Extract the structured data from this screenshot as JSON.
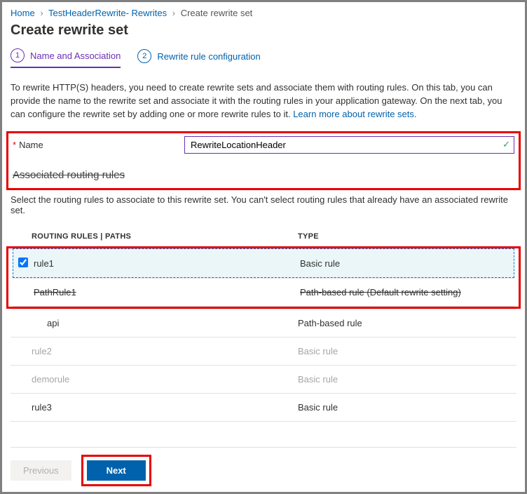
{
  "breadcrumb": {
    "home": "Home",
    "mid": "TestHeaderRewrite- Rewrites",
    "current": "Create rewrite set"
  },
  "page_title": "Create rewrite set",
  "tabs": {
    "t1_num": "1",
    "t1_label": "Name and Association",
    "t2_num": "2",
    "t2_label": "Rewrite rule configuration"
  },
  "description": {
    "text": "To rewrite HTTP(S) headers, you need to create rewrite sets and associate them with routing rules. On this tab, you can provide the name to the rewrite set and associate it with the routing rules in your application gateway. On the next tab, you can configure the rewrite set by adding one or more rewrite rules to it.  ",
    "link": "Learn more about rewrite sets."
  },
  "name_field": {
    "label": "Name",
    "value": "RewriteLocationHeader"
  },
  "assoc": {
    "heading": "Associated routing rules",
    "sub": "Select the routing rules to associate to this rewrite set. You can't select routing rules that already have an associated rewrite set."
  },
  "table": {
    "col1": "ROUTING RULES | PATHS",
    "col2": "TYPE",
    "rows": [
      {
        "name": "rule1",
        "type": "Basic rule",
        "selected": true,
        "disabled": false,
        "indent": false,
        "strike": false
      },
      {
        "name": "PathRule1",
        "type": "Path-based rule (Default rewrite setting)",
        "selected": false,
        "disabled": false,
        "indent": false,
        "strike": true
      },
      {
        "name": "api",
        "type": "Path-based rule",
        "selected": false,
        "disabled": false,
        "indent": true,
        "strike": false
      },
      {
        "name": "rule2",
        "type": "Basic rule",
        "selected": false,
        "disabled": true,
        "indent": false,
        "strike": false
      },
      {
        "name": "demorule",
        "type": "Basic rule",
        "selected": false,
        "disabled": true,
        "indent": false,
        "strike": false
      },
      {
        "name": "rule3",
        "type": "Basic rule",
        "selected": false,
        "disabled": false,
        "indent": false,
        "strike": false
      }
    ]
  },
  "footer": {
    "prev": "Previous",
    "next": "Next"
  }
}
